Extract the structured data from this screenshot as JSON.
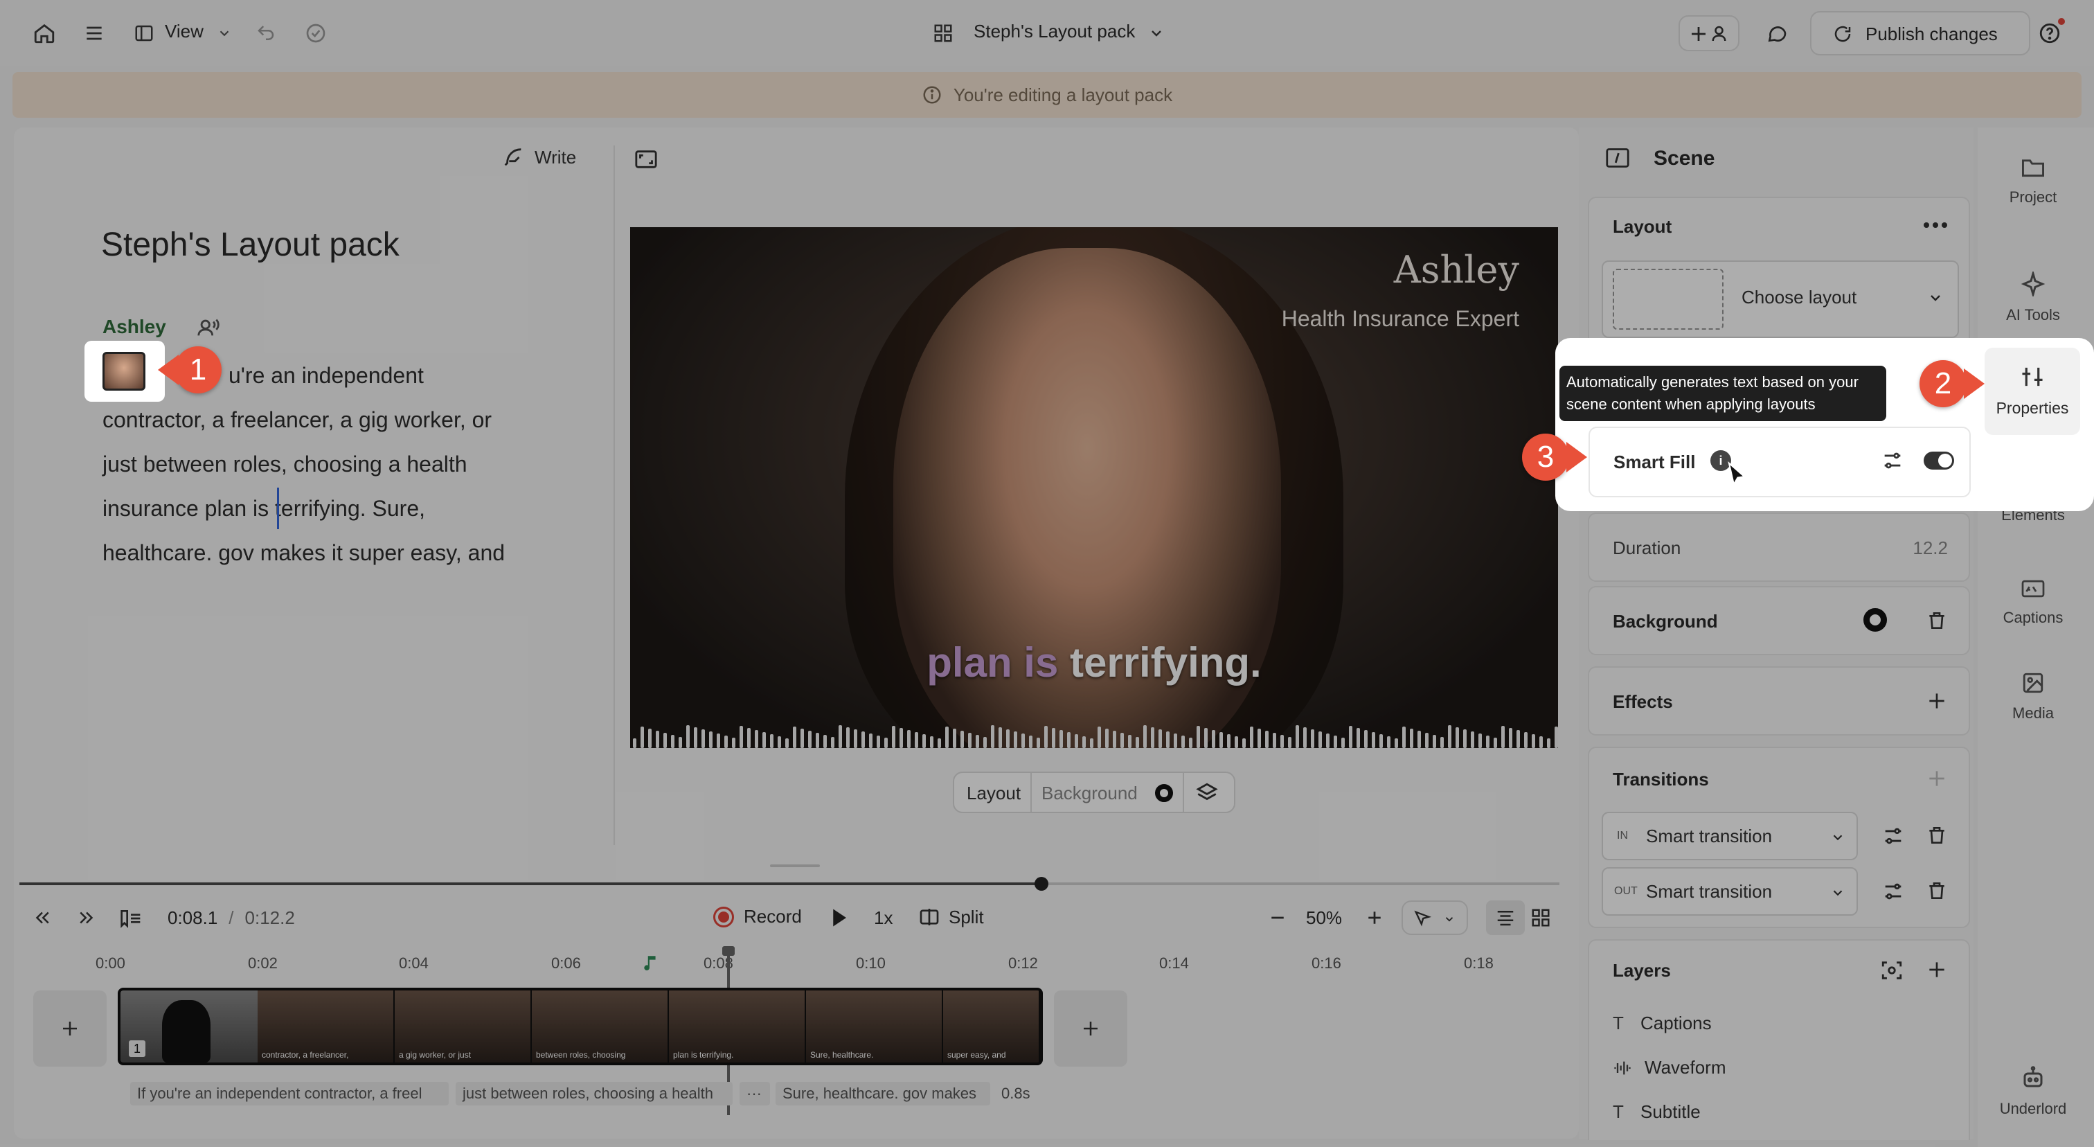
{
  "topbar": {
    "view_label": "View",
    "project_title": "Steph's Layout pack",
    "publish_label": "Publish changes"
  },
  "banner": {
    "text": "You're editing a layout pack"
  },
  "editor": {
    "write_label": "Write",
    "doc_title": "Steph's Layout pack",
    "speaker": "Ashley",
    "lines": [
      "u're an independent",
      "contractor, a freelancer, a gig worker, or",
      "just between roles, choosing a health",
      "insurance plan is terrifying. Sure,",
      "healthcare. gov makes it super easy, and"
    ]
  },
  "video": {
    "name": "Ashley",
    "role": "Health Insurance Expert",
    "caption_highlight": "plan is",
    "caption_rest": "terrifying."
  },
  "below_video": {
    "layout": "Layout",
    "background": "Background"
  },
  "scene": {
    "title": "Scene",
    "layout_title": "Layout",
    "choose_layout": "Choose layout",
    "tooltip": "Automatically generates text based on your scene content when applying layouts",
    "smart_fill": "Smart Fill",
    "duration_label": "Duration",
    "duration_value": "12.2",
    "background_title": "Background",
    "effects_title": "Effects",
    "transitions_title": "Transitions",
    "transition_in_tag": "IN",
    "transition_out_tag": "OUT",
    "transition_in": "Smart transition",
    "transition_out": "Smart transition",
    "layers_title": "Layers",
    "layers": [
      "Captions",
      "Waveform",
      "Subtitle"
    ]
  },
  "rail": [
    "Project",
    "AI Tools",
    "Properties",
    "Elements",
    "Captions",
    "Media",
    "Underlord"
  ],
  "callouts": [
    "1",
    "2",
    "3"
  ],
  "transport": {
    "current": "0:08.1",
    "separator": "/",
    "total": "0:12.2",
    "record": "Record",
    "speed": "1x",
    "split": "Split",
    "zoom": "50%"
  },
  "ruler": [
    "0:00",
    "0:02",
    "0:04",
    "0:06",
    "0:08",
    "0:10",
    "0:12",
    "0:14",
    "0:16",
    "0:18"
  ],
  "clip_index": "1",
  "thumb_captions": [
    "contractor, a freelancer,",
    "a gig worker, or just",
    "between roles, choosing",
    "plan is terrifying.",
    "Sure, healthcare.",
    "super easy, and"
  ],
  "caption_chips": [
    "If you're an independent contractor, a freel",
    "just between roles, choosing a health",
    "···",
    "Sure, healthcare. gov makes",
    "0.8s"
  ],
  "colors": {
    "accent_red": "#e8513a",
    "banner": "#f3e4d3",
    "speaker_green": "#2e6b3a",
    "caption_purple": "#b07bbf"
  }
}
